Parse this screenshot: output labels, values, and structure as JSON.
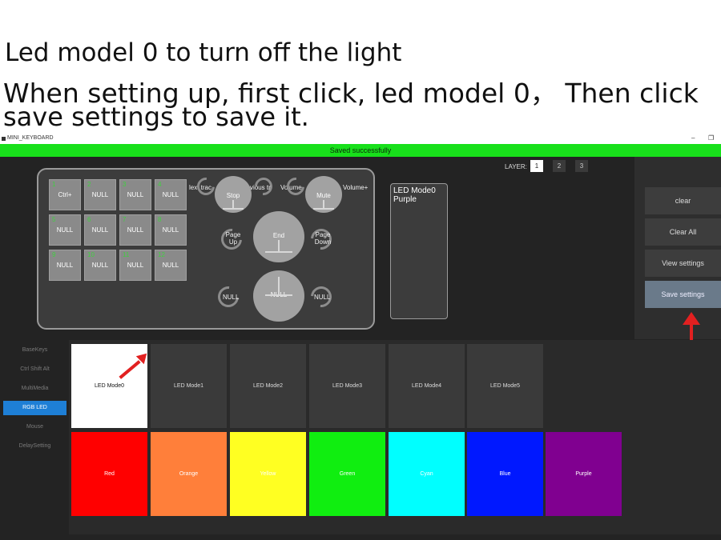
{
  "caption": {
    "line1": "Led model 0 to turn off the light",
    "line2": "When setting up, first click, led model 0， Then click",
    "line3": "save settings to save it."
  },
  "window": {
    "title": "MINI_KEYBOARD",
    "minimize": "–",
    "restore": "❐",
    "status": "Saved successfully",
    "status_color": "#18e01b"
  },
  "layer": {
    "label": "LAYER:",
    "buttons": [
      "1",
      "2",
      "3"
    ],
    "active": "1"
  },
  "keys": [
    {
      "num": "1",
      "label": "Ctrl+"
    },
    {
      "num": "2",
      "label": "NULL"
    },
    {
      "num": "3",
      "label": "NULL"
    },
    {
      "num": "4",
      "label": "NULL"
    },
    {
      "num": "5",
      "label": "NULL"
    },
    {
      "num": "6",
      "label": "NULL"
    },
    {
      "num": "7",
      "label": "NULL"
    },
    {
      "num": "8",
      "label": "NULL"
    },
    {
      "num": "9",
      "label": "NULL"
    },
    {
      "num": "10",
      "label": "NULL"
    },
    {
      "num": "11",
      "label": "NULL"
    },
    {
      "num": "12",
      "label": "NULL"
    }
  ],
  "knobs": {
    "k1": {
      "left": "lext trac",
      "center": "Stop",
      "right": "vious tr"
    },
    "k2": {
      "left": "Volume-",
      "center": "Mute",
      "right": "Volume+"
    },
    "k3": {
      "left": "Page Up",
      "center": "End",
      "right": "Page Down"
    },
    "k4": {
      "left": "NULL",
      "center": "NULL",
      "right": "NULL"
    }
  },
  "led_display": {
    "line1": "LED Mode0",
    "line2": "Purple"
  },
  "right_buttons": {
    "clear": "clear",
    "clear_all": "Clear All",
    "view": "View settings",
    "save": "Save settings"
  },
  "left_menu": [
    {
      "label": "BaseKeys",
      "active": false
    },
    {
      "label": "Ctrl Shift Alt",
      "active": false
    },
    {
      "label": "MultiMedia",
      "active": false
    },
    {
      "label": "RGB LED",
      "active": true
    },
    {
      "label": "Mouse",
      "active": false
    },
    {
      "label": "DelaySetting",
      "active": false
    }
  ],
  "led_modes": [
    "LED Mode0",
    "LED Mode1",
    "LED Mode2",
    "LED Mode3",
    "LED Mode4",
    "LED Mode5"
  ],
  "selected_mode": "LED Mode0",
  "colors": [
    {
      "label": "Red",
      "hex": "#ff0000"
    },
    {
      "label": "Orange",
      "hex": "#ff7f3a"
    },
    {
      "label": "Yellow",
      "hex": "#ffff22"
    },
    {
      "label": "Green",
      "hex": "#10ee10"
    },
    {
      "label": "Cyan",
      "hex": "#00ffff"
    },
    {
      "label": "Blue",
      "hex": "#0018ff"
    },
    {
      "label": "Purple",
      "hex": "#800090"
    }
  ],
  "annotation_color": "#e22020"
}
